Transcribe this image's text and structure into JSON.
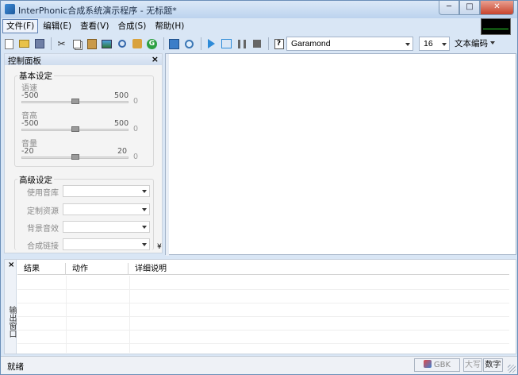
{
  "window": {
    "title": "InterPhonic合成系统演示程序 - 无标题*",
    "buttons": {
      "minimize": "─",
      "maximize": "□",
      "close": "✕"
    }
  },
  "menu": {
    "items": [
      {
        "label": "文件(F)"
      },
      {
        "label": "编辑(E)"
      },
      {
        "label": "查看(V)"
      },
      {
        "label": "合成(S)"
      },
      {
        "label": "帮助(H)"
      }
    ]
  },
  "toolbar": {
    "icons": [
      "new-file-icon",
      "open-folder-icon",
      "save-icon",
      "cut-icon",
      "copy-icon",
      "paste-icon",
      "image-icon",
      "find-icon",
      "replace-icon",
      "go-icon",
      "document-icon",
      "zoom-icon",
      "play-icon",
      "play-selection-icon",
      "pause-icon",
      "stop-icon",
      "help-icon"
    ],
    "font": "Garamond",
    "size": "16",
    "encoding": "文本编码"
  },
  "control_panel": {
    "title": "控制面板",
    "close": "×",
    "basic": {
      "title": "基本设定",
      "speed": {
        "label": "语速",
        "min": "-500",
        "max": "500",
        "value": "0"
      },
      "pitch": {
        "label": "音高",
        "min": "-500",
        "max": "500",
        "value": "0"
      },
      "volume": {
        "label": "音量",
        "min": "-20",
        "max": "20",
        "value": "0"
      }
    },
    "advanced": {
      "title": "高级设定",
      "fields": [
        {
          "label": "使用音库"
        },
        {
          "label": "定制资源"
        },
        {
          "label": "背景音效"
        },
        {
          "label": "合成链接"
        }
      ]
    },
    "collapse": "¥"
  },
  "output_panel": {
    "close": "×",
    "side_label": "输出窗口",
    "columns": [
      "结果",
      "动作",
      "详细说明"
    ]
  },
  "statusbar": {
    "status": "就绪",
    "gbk": "GBK",
    "caps": "大写",
    "num": "数字"
  },
  "colors": {
    "title_gradient": "#bcd3ee",
    "meter_bg": "#000000",
    "meter_line": "#2bd82b",
    "close_btn": "#c7432c"
  }
}
